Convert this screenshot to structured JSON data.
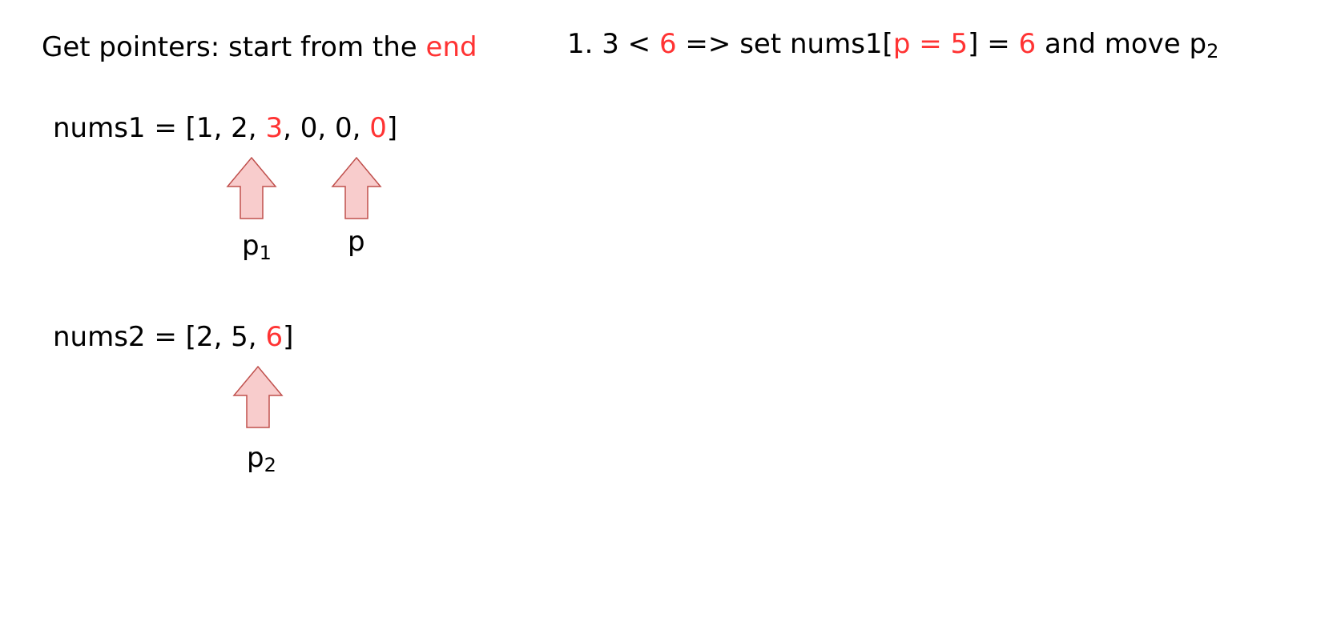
{
  "heading": {
    "prefix": "Get pointers: start from the ",
    "highlight": "end"
  },
  "step": {
    "n1": "1. 3 < ",
    "h1": "6",
    "n2": " => set nums1[",
    "h2": "p = 5",
    "n3": "] = ",
    "h3": "6",
    "n4": " and move p",
    "sub": "2"
  },
  "nums1": {
    "a": "nums1 = [1, 2, ",
    "h1": "3",
    "b": ", 0, 0, ",
    "h2": "0",
    "c": "]"
  },
  "nums2": {
    "a": "nums2 = [2, 5, ",
    "h1": "6",
    "b": "]"
  },
  "pointers": {
    "p1": {
      "base": "p",
      "sub": "1"
    },
    "p": {
      "base": "p"
    },
    "p2": {
      "base": "p",
      "sub": "2"
    }
  },
  "colors": {
    "highlight": "#ff3333",
    "arrow_fill": "#f8cccc",
    "arrow_stroke": "#c0504d"
  }
}
